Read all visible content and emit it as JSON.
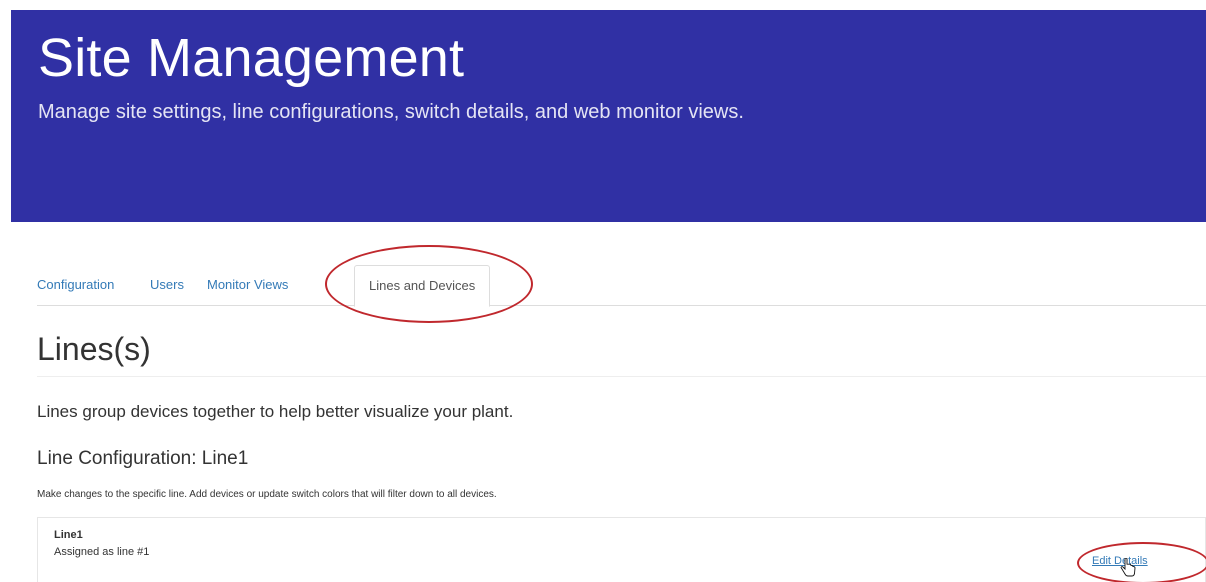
{
  "hero": {
    "title": "Site Management",
    "subtitle": "Manage site settings, line configurations, switch details, and web monitor views."
  },
  "tabs": [
    {
      "label": "Configuration",
      "active": false
    },
    {
      "label": "Users",
      "active": false
    },
    {
      "label": "Monitor Views",
      "active": false
    },
    {
      "label": "Lines and Devices",
      "active": true
    }
  ],
  "section": {
    "title": "Lines(s)",
    "lead": "Lines group devices together to help better visualize your plant."
  },
  "line_config": {
    "title": "Line Configuration: Line1",
    "description": "Make changes to the specific line. Add devices or update switch colors that will filter down to all devices."
  },
  "line_panel": {
    "name": "Line1",
    "assigned": "Assigned as line #1",
    "edit_label": "Edit Details"
  },
  "colors": {
    "hero_background": "#3030a4",
    "link": "#337ab7",
    "highlight_annotation": "#c0282d"
  },
  "icons": {
    "cursor": "hand-pointer-cursor-icon"
  }
}
